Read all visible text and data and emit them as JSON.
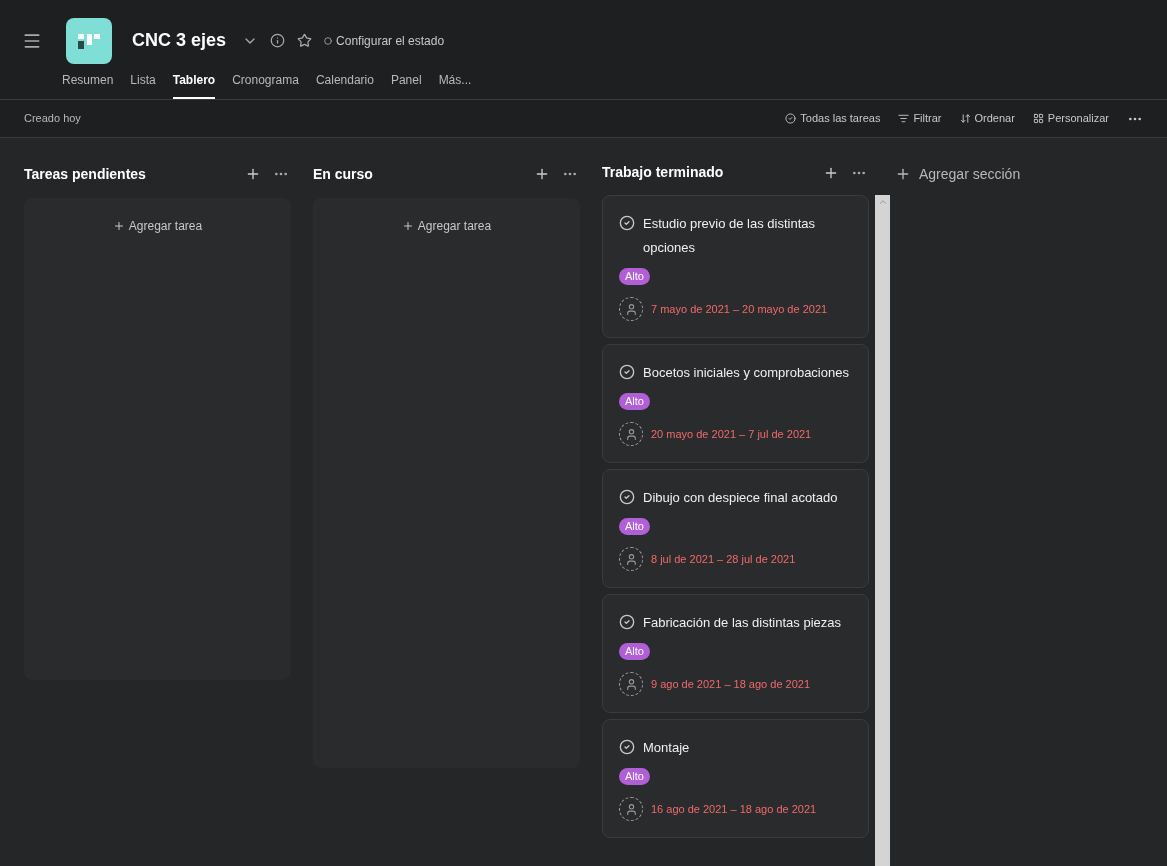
{
  "project": {
    "title": "CNC 3 ejes",
    "status": "Configurar el estado"
  },
  "tabs": [
    {
      "label": "Resumen",
      "selected": false
    },
    {
      "label": "Lista",
      "selected": false
    },
    {
      "label": "Tablero",
      "selected": true
    },
    {
      "label": "Cronograma",
      "selected": false
    },
    {
      "label": "Calendario",
      "selected": false
    },
    {
      "label": "Panel",
      "selected": false
    },
    {
      "label": "Más...",
      "selected": false
    }
  ],
  "toolbar": {
    "created": "Creado hoy",
    "actions": [
      {
        "kind": "tasks",
        "label": "Todas las tareas"
      },
      {
        "kind": "filter",
        "label": "Filtrar"
      },
      {
        "kind": "sort",
        "label": "Ordenar"
      },
      {
        "kind": "customize",
        "label": "Personalizar"
      }
    ]
  },
  "columns": [
    {
      "title": "Tareas pendientes",
      "add_task": "Agregar tarea"
    },
    {
      "title": "En curso",
      "add_task": "Agregar tarea"
    },
    {
      "title": "Trabajo terminado",
      "tasks": [
        {
          "name": "Estudio previo de las distintas opciones",
          "tag": "Alto",
          "dates": "7 mayo de 2021 – 20 mayo de 2021"
        },
        {
          "name": "Bocetos iniciales y comprobaciones",
          "tag": "Alto",
          "dates": "20 mayo de 2021 – 7 jul de 2021"
        },
        {
          "name": "Dibujo con despiece final acotado",
          "tag": "Alto",
          "dates": "8 jul de 2021 – 28 jul de 2021"
        },
        {
          "name": "Fabricación de las distintas piezas",
          "tag": "Alto",
          "dates": "9 ago de 2021 – 18 ago de 2021"
        },
        {
          "name": "Montaje",
          "tag": "Alto",
          "dates": "16 ago de 2021 – 18 ago de 2021"
        }
      ]
    }
  ],
  "add_section": "Agregar sección"
}
